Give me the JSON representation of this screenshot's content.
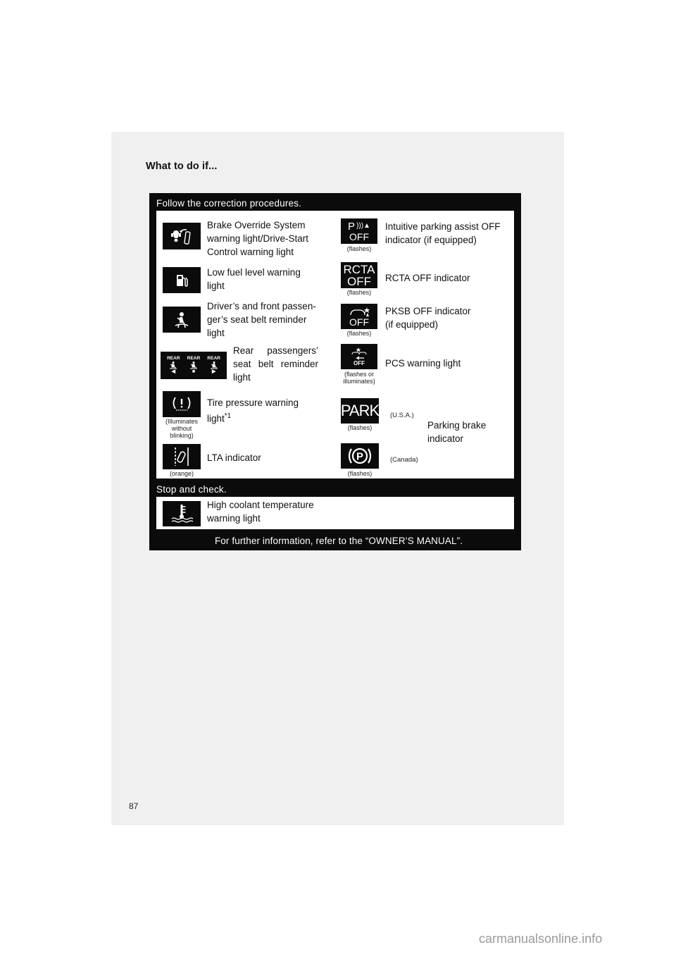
{
  "heading": "What to do if...",
  "section_follow": {
    "title": "Follow the correction procedures.",
    "left_items": [
      {
        "icon": "brake-override-icon",
        "label_lines": [
          "Brake Override System",
          "warning light/Drive-Start",
          "Control warning light"
        ],
        "caption": ""
      },
      {
        "icon": "fuel-pump-icon",
        "label_lines": [
          "Low fuel level warning",
          "light"
        ],
        "caption": ""
      },
      {
        "icon": "seat-belt-icon",
        "label_lines": [
          "Driver’s and front passen-",
          "ger’s seat belt reminder",
          "light"
        ],
        "caption": ""
      },
      {
        "icon": "rear-seat-belt-icon",
        "label_lines": [
          "Rear passengers’",
          "seat belt reminder",
          "light"
        ],
        "caption": "",
        "icon_text": [
          "REAR",
          "REAR",
          "REAR"
        ]
      },
      {
        "icon": "tire-pressure-icon",
        "label_lines": [
          "Tire pressure warning",
          "light"
        ],
        "superscript": "*1",
        "caption_lines": [
          "(Illuminates",
          "without",
          "blinking)"
        ]
      },
      {
        "icon": "lane-trace-icon",
        "label_lines": [
          "LTA indicator"
        ],
        "caption": "(orange)"
      }
    ],
    "right_items": [
      {
        "icon": "parking-assist-off-icon",
        "icon_text": [
          "P",
          "OFF"
        ],
        "label_lines": [
          "Intuitive parking assist OFF",
          "indicator (if equipped)"
        ],
        "caption": "(flashes)"
      },
      {
        "icon": "rcta-off-icon",
        "icon_text": [
          "RCTA",
          "OFF"
        ],
        "label_lines": [
          "RCTA OFF indicator"
        ],
        "caption": "(flashes)"
      },
      {
        "icon": "pksb-off-icon",
        "icon_text": [
          "OFF"
        ],
        "label_lines": [
          "PKSB OFF indicator",
          "(if equipped)"
        ],
        "caption": "(flashes)"
      },
      {
        "icon": "pcs-warning-icon",
        "icon_text": [
          "OFF"
        ],
        "label_lines": [
          "PCS warning light"
        ],
        "caption_lines": [
          "(flashes or",
          "illuminates)"
        ]
      }
    ],
    "parking_brake": {
      "label_lines": [
        "Parking brake",
        "indicator"
      ],
      "usa": {
        "icon": "park-text-icon",
        "icon_text": "PARK",
        "caption": "(flashes)",
        "region": "(U.S.A.)"
      },
      "canada": {
        "icon": "parking-brake-circle-icon",
        "icon_text": "P",
        "caption": "(flashes)",
        "region": "(Canada)"
      }
    }
  },
  "section_stop": {
    "title": "Stop and check.",
    "items": [
      {
        "icon": "coolant-temperature-icon",
        "label_lines": [
          "High coolant temperature",
          "warning light"
        ]
      }
    ]
  },
  "footer_note": "For further information, refer to the “OWNER’S MANUAL”.",
  "page_number": "87",
  "watermark": "carmanualsonline.info",
  "colors": {
    "panel": "#0b0b0b",
    "page_bg": "#eff0ef",
    "text": "#111111"
  }
}
